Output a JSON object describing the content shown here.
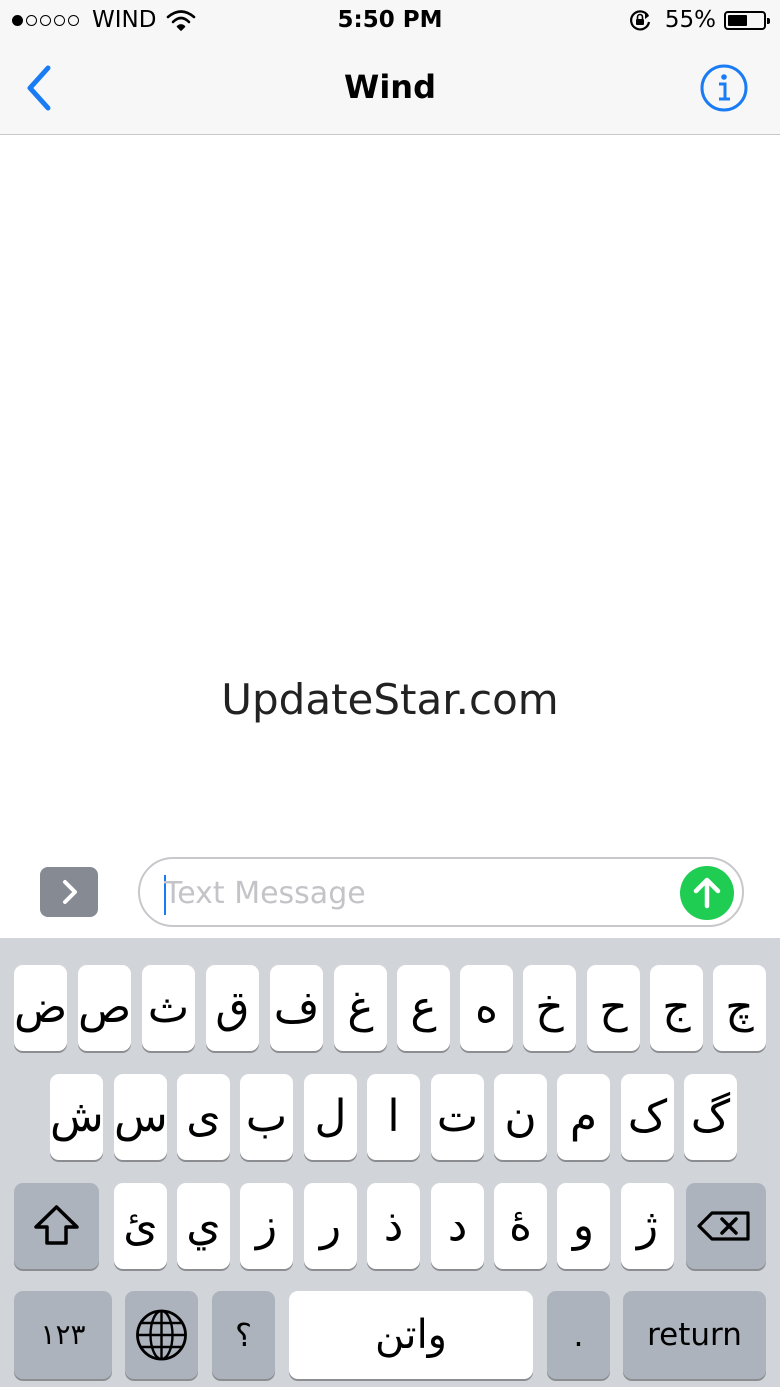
{
  "status_bar": {
    "carrier": "WIND",
    "signal_bars_filled": 1,
    "signal_bars_total": 5,
    "time": "5:50 PM",
    "battery_percent": "55%",
    "battery_level": 0.55,
    "icons": [
      "wifi-icon",
      "rotation-lock-icon",
      "battery-icon"
    ]
  },
  "nav": {
    "title": "Wind",
    "back_icon": "chevron-left-icon",
    "info_icon": "info-icon",
    "accent_color": "#1a7cf5"
  },
  "watermark": "UpdateStar.com",
  "input": {
    "placeholder": "Text Message",
    "value": "",
    "expand_icon": "chevron-right-icon",
    "send_icon": "arrow-up-icon",
    "send_color": "#1fcd52"
  },
  "keyboard": {
    "row1": [
      "ض",
      "ص",
      "ث",
      "ق",
      "ف",
      "غ",
      "ع",
      "ه",
      "خ",
      "ح",
      "ج",
      "چ"
    ],
    "row2": [
      "ش",
      "س",
      "ی",
      "ب",
      "ل",
      "ا",
      "ت",
      "ن",
      "م",
      "ک",
      "گ"
    ],
    "row3": [
      "ئ",
      "ي",
      "ز",
      "ر",
      "ذ",
      "د",
      "ۀ",
      "و",
      "ژ"
    ],
    "shift_icon": "shift-arrow-icon",
    "delete_icon": "backspace-icon",
    "numbers_label": "۱۲۳",
    "globe_icon": "globe-icon",
    "question_label": "؟",
    "space_label": "واتن",
    "period_label": ".",
    "return_label": "return"
  }
}
